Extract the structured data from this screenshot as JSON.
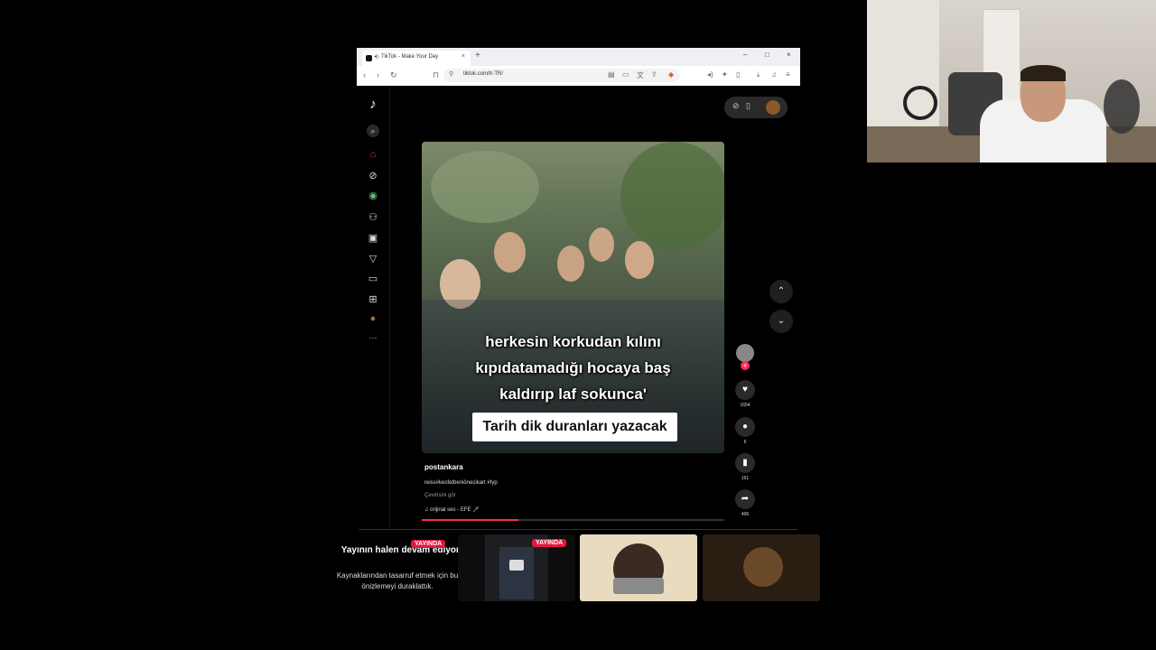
{
  "browser": {
    "tab_title": "TikTok - Make Your Day",
    "tab_close": "×",
    "new_tab": "+",
    "url": "tiktok.com/tr-TR/",
    "window": {
      "minimize": "–",
      "maximize": "□",
      "close": "×"
    }
  },
  "sidebar": {
    "logo": "♪",
    "items": [
      {
        "icon": "search-icon",
        "glyph": "⌕"
      },
      {
        "icon": "home-icon",
        "glyph": "⌂"
      },
      {
        "icon": "explore-icon",
        "glyph": "⊘"
      },
      {
        "icon": "profile-globe-icon",
        "glyph": "◉"
      },
      {
        "icon": "following-icon",
        "glyph": "⚇"
      },
      {
        "icon": "live-icon",
        "glyph": "▣"
      },
      {
        "icon": "send-icon",
        "glyph": "▽"
      },
      {
        "icon": "messages-icon",
        "glyph": "▭"
      },
      {
        "icon": "upload-icon",
        "glyph": "⊞"
      },
      {
        "icon": "avatar-icon",
        "glyph": "●"
      },
      {
        "icon": "more-icon",
        "glyph": "···"
      }
    ]
  },
  "video": {
    "caption_lines": [
      "herkesin korkudan kılını",
      "kıpıdatamadığı hocaya baş",
      "kaldırıp laf sokunca'"
    ],
    "caption_box": "Tarih dik duranları yazacak",
    "author": "postankara",
    "description": "reiss#kesfetbeniönecikart #fyp",
    "translate": "Çevirisini gör",
    "music": "♫  orijinal ses - EFE 🗡",
    "progress": 0.32
  },
  "actions": {
    "likes": "1654",
    "comments": "6",
    "saves": "161",
    "shares": "406",
    "follow": "+"
  },
  "nav": {
    "up": "⌃",
    "down": "⌄"
  },
  "bottom": {
    "notice_title": "Yayının halen devam ediyor!",
    "notice_body": "Kaynaklarından tasarruf etmek için bu önizlemeyi duraklattık.",
    "badge1": "YAYINDA",
    "badge2": "YAYINDA"
  },
  "colors": {
    "accent": "#fe2c55",
    "live": "#e0193f"
  }
}
